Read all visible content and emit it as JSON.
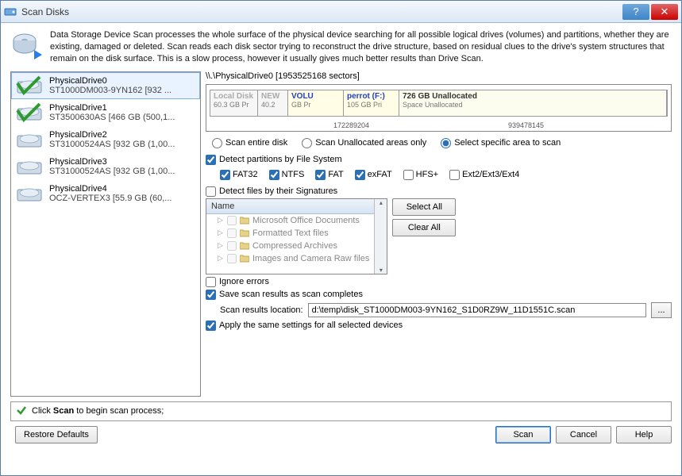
{
  "window": {
    "title": "Scan Disks"
  },
  "intro": "Data Storage Device Scan processes the whole surface of the physical device  searching for all possible logical drives (volumes) and partitions, whether they are existing, damaged or deleted. Scan reads each disk sector trying to reconstruct the drive structure, based on residual clues to the drive's system structures that remain on the disk surface. This is a slow process, however it usually gives much better results than Drive Scan.",
  "drives": [
    {
      "name": "PhysicalDrive0",
      "desc": "ST1000DM003-9YN162 [932 ...",
      "checked": true,
      "selected": true
    },
    {
      "name": "PhysicalDrive1",
      "desc": "ST3500630AS [466 GB (500,1...",
      "checked": true,
      "selected": false
    },
    {
      "name": "PhysicalDrive2",
      "desc": "ST31000524AS [932 GB (1,00...",
      "checked": false,
      "selected": false
    },
    {
      "name": "PhysicalDrive3",
      "desc": "ST31000524AS [932 GB (1,00...",
      "checked": false,
      "selected": false
    },
    {
      "name": "PhysicalDrive4",
      "desc": "OCZ-VERTEX3 [55.9 GB (60,...",
      "checked": false,
      "selected": false
    }
  ],
  "path": "\\\\.\\PhysicalDrive0 [1953525168 sectors]",
  "partitions": [
    {
      "name": "Local Disk",
      "size": "60.3 GB Pr"
    },
    {
      "name": "NEW",
      "size": "40.2"
    },
    {
      "name": "VOLU",
      "size": "GB Pr"
    },
    {
      "name": "perrot (F:)",
      "size": "105 GB Pri"
    },
    {
      "name": "726 GB Unallocated",
      "size": "Space Unallocated"
    }
  ],
  "plabels": {
    "a": "172289204",
    "b": "939478145"
  },
  "scanmode": {
    "entire": "Scan entire disk",
    "unalloc": "Scan Unallocated areas only",
    "specific": "Select specific area to scan"
  },
  "detectfs": {
    "label": "Detect partitions by File System",
    "items": [
      "FAT32",
      "NTFS",
      "FAT",
      "exFAT",
      "HFS+",
      "Ext2/Ext3/Ext4"
    ],
    "checked": [
      true,
      true,
      true,
      true,
      false,
      false
    ]
  },
  "detectsig": {
    "label": "Detect files by their Signatures",
    "header": "Name",
    "items": [
      "Microsoft Office Documents",
      "Formatted Text files",
      "Compressed Archives",
      "Images and Camera Raw files"
    ],
    "selectall": "Select All",
    "clearall": "Clear All"
  },
  "options": {
    "ignore": "Ignore errors",
    "save": "Save scan results as scan completes",
    "loclabel": "Scan results location:",
    "locvalue": "d:\\temp\\disk_ST1000DM003-9YN162_S1D0RZ9W_11D1551C.scan",
    "applysame": "Apply the same settings for all selected devices"
  },
  "status": "Click Scan to begin scan process;",
  "buttons": {
    "restore": "Restore Defaults",
    "scan": "Scan",
    "cancel": "Cancel",
    "help": "Help",
    "browse": "..."
  },
  "status_highlight": "Scan"
}
